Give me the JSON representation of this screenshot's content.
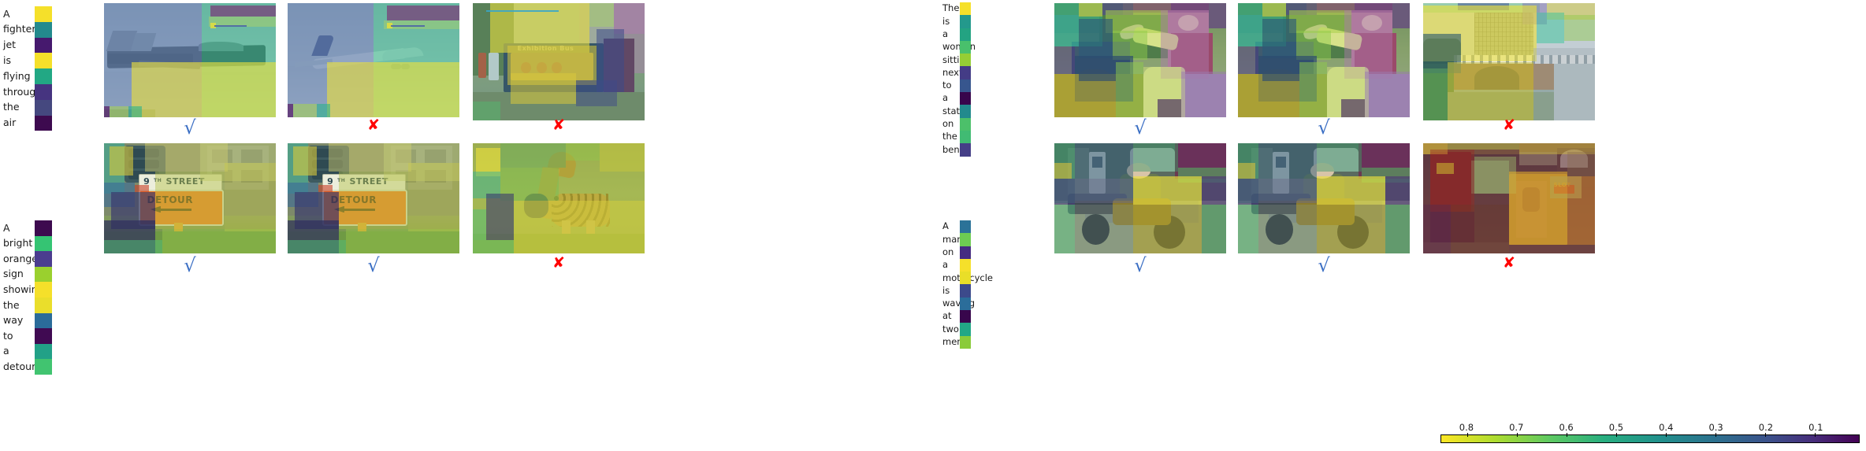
{
  "figure": {
    "type": "visual-grounding-attention-grid",
    "rows": 2,
    "groups_per_row": 2,
    "images_per_group": 3
  },
  "colorbar": {
    "name": "attention-weight-colorbar",
    "ticks": [
      "0.8",
      "0.7",
      "0.6",
      "0.5",
      "0.4",
      "0.3",
      "0.2",
      "0.1"
    ],
    "orientation": "horizontal",
    "direction": "descending",
    "colormap": "viridis-reversed",
    "high_color": "#fde725",
    "low_color": "#440154"
  },
  "marks": {
    "correct": "√",
    "incorrect": "✘",
    "correct_color": "#3b6fc4",
    "incorrect_color": "#ff0000"
  },
  "captions": [
    {
      "id": "caption-fighter-jet",
      "words": [
        "A",
        "fighter",
        "jet",
        "is",
        "flying",
        "through",
        "the",
        "air"
      ],
      "weights": [
        0.82,
        0.45,
        0.12,
        0.8,
        0.52,
        0.18,
        0.22,
        0.07
      ],
      "colors": [
        "#f5e02a",
        "#238a8d",
        "#46196e",
        "#f5e02a",
        "#22a884",
        "#463480",
        "#45487f",
        "#3d0a4f"
      ]
    },
    {
      "id": "caption-detour-sign",
      "words": [
        "A",
        "bright",
        "orange",
        "sign",
        "showing",
        "the",
        "way",
        "to",
        "a",
        "detour"
      ],
      "weights": [
        0.06,
        0.55,
        0.16,
        0.72,
        0.81,
        0.79,
        0.36,
        0.07,
        0.48,
        0.58
      ],
      "colors": [
        "#3d0a4f",
        "#35c473",
        "#4b3d8f",
        "#9ad02e",
        "#f5e02a",
        "#eade2b",
        "#2b6c9a",
        "#400a52",
        "#22a187",
        "#41c470"
      ]
    },
    {
      "id": "caption-woman-statue",
      "words": [
        "There",
        "is",
        "a",
        "woman",
        "sitting",
        "next",
        "to",
        "a",
        "statue",
        "on",
        "the",
        "bench"
      ],
      "weights": [
        0.83,
        0.47,
        0.5,
        0.58,
        0.7,
        0.19,
        0.32,
        0.06,
        0.45,
        0.57,
        0.55,
        0.2
      ],
      "colors": [
        "#f5e02a",
        "#23998c",
        "#23a382",
        "#49c06c",
        "#95ce35",
        "#443c86",
        "#37568e",
        "#38064c",
        "#228a8d",
        "#4cc06a",
        "#41bb73",
        "#453f87"
      ]
    },
    {
      "id": "caption-man-motorcycle",
      "words": [
        "A",
        "man",
        "on",
        "a",
        "motorcycle",
        "is",
        "waving",
        "at",
        "two",
        "men"
      ],
      "weights": [
        0.33,
        0.62,
        0.17,
        0.8,
        0.77,
        0.26,
        0.35,
        0.05,
        0.5,
        0.66
      ],
      "colors": [
        "#2b7298",
        "#6dcb52",
        "#452b81",
        "#f5e02a",
        "#e9de28",
        "#3c4a8b",
        "#2b6d9a",
        "#38064c",
        "#22a786",
        "#8acb3a"
      ]
    }
  ],
  "panels": [
    {
      "id": "panel-fighter-jet",
      "group": "top-left",
      "index": 0,
      "scene": "fighter jet in flight",
      "verdict": "correct"
    },
    {
      "id": "panel-airliner",
      "group": "top-left",
      "index": 1,
      "scene": "commercial airliner taking off",
      "verdict": "incorrect"
    },
    {
      "id": "panel-exhibition-bus",
      "group": "top-left",
      "index": 2,
      "scene": "people beside an Exhibition Bus",
      "verdict": "incorrect"
    },
    {
      "id": "panel-woman-statue-a",
      "group": "top-right",
      "index": 0,
      "scene": "woman seated beside statue on bench",
      "verdict": "correct"
    },
    {
      "id": "panel-woman-statue-b",
      "group": "top-right",
      "index": 1,
      "scene": "woman seated beside statue on bench",
      "verdict": "correct"
    },
    {
      "id": "panel-gasholder-bridge",
      "group": "top-right",
      "index": 2,
      "scene": "train crossing a bridge by a gasholder",
      "verdict": "incorrect"
    },
    {
      "id": "panel-detour-a",
      "group": "bottom-left",
      "index": 0,
      "scene": "9th Street sign above orange DETOUR sign",
      "verdict": "correct"
    },
    {
      "id": "panel-detour-b",
      "group": "bottom-left",
      "index": 1,
      "scene": "9th Street sign above orange DETOUR sign",
      "verdict": "correct"
    },
    {
      "id": "panel-giraffe",
      "group": "bottom-left",
      "index": 2,
      "scene": "giraffe grazing on grass",
      "verdict": "incorrect"
    },
    {
      "id": "panel-motorcycle-a",
      "group": "bottom-right",
      "index": 0,
      "scene": "man on a motorcycle at a petrol pump",
      "verdict": "correct"
    },
    {
      "id": "panel-motorcycle-b",
      "group": "bottom-right",
      "index": 1,
      "scene": "man on a motorcycle at a petrol pump",
      "verdict": "correct"
    },
    {
      "id": "panel-shop-interior",
      "group": "bottom-right",
      "index": 2,
      "scene": "shop interior with lit display cabinet",
      "verdict": "incorrect"
    }
  ],
  "image_labels": {
    "street_sign_number": "9",
    "street_sign_suffix": "TH",
    "street_sign_word": "STREET",
    "detour_word": "DETOUR",
    "bus_word": "Exhibition Bus",
    "shop_word": "SLOT"
  }
}
